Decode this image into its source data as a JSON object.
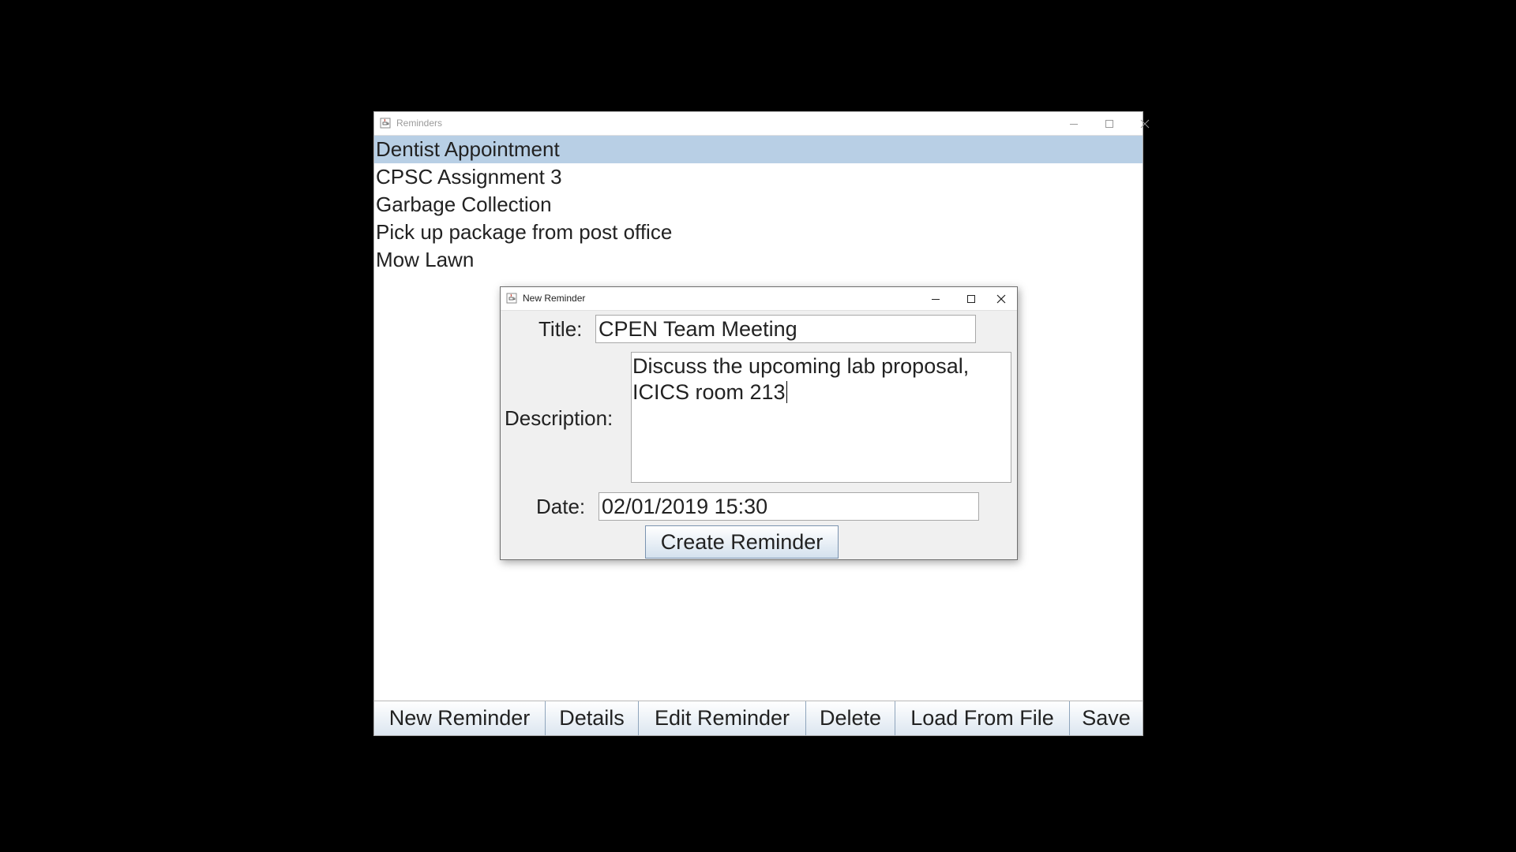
{
  "main_window": {
    "title": "Reminders",
    "reminders": [
      "Dentist Appointment",
      "CPSC Assignment 3",
      "Garbage Collection",
      "Pick up package from post office",
      "Mow Lawn"
    ],
    "selected_index": 0,
    "buttons": [
      "New Reminder",
      "Details",
      "Edit Reminder",
      "Delete",
      "Load From File",
      "Save"
    ]
  },
  "dialog": {
    "title": "New Reminder",
    "title_label": "Title:",
    "title_value": "CPEN Team Meeting",
    "description_label": "Description:",
    "description_value": "Discuss the upcoming lab proposal,\nICICS room 213",
    "date_label": "Date:",
    "date_value": "02/01/2019 15:30",
    "create_button": "Create Reminder"
  },
  "icons": {
    "app": "java-cup-icon",
    "minimize": "minimize-icon",
    "maximize": "maximize-icon",
    "close": "close-icon"
  },
  "colors": {
    "selection": "#b8cfe5",
    "background": "#000000",
    "dialog_bg": "#f0f0f0"
  }
}
